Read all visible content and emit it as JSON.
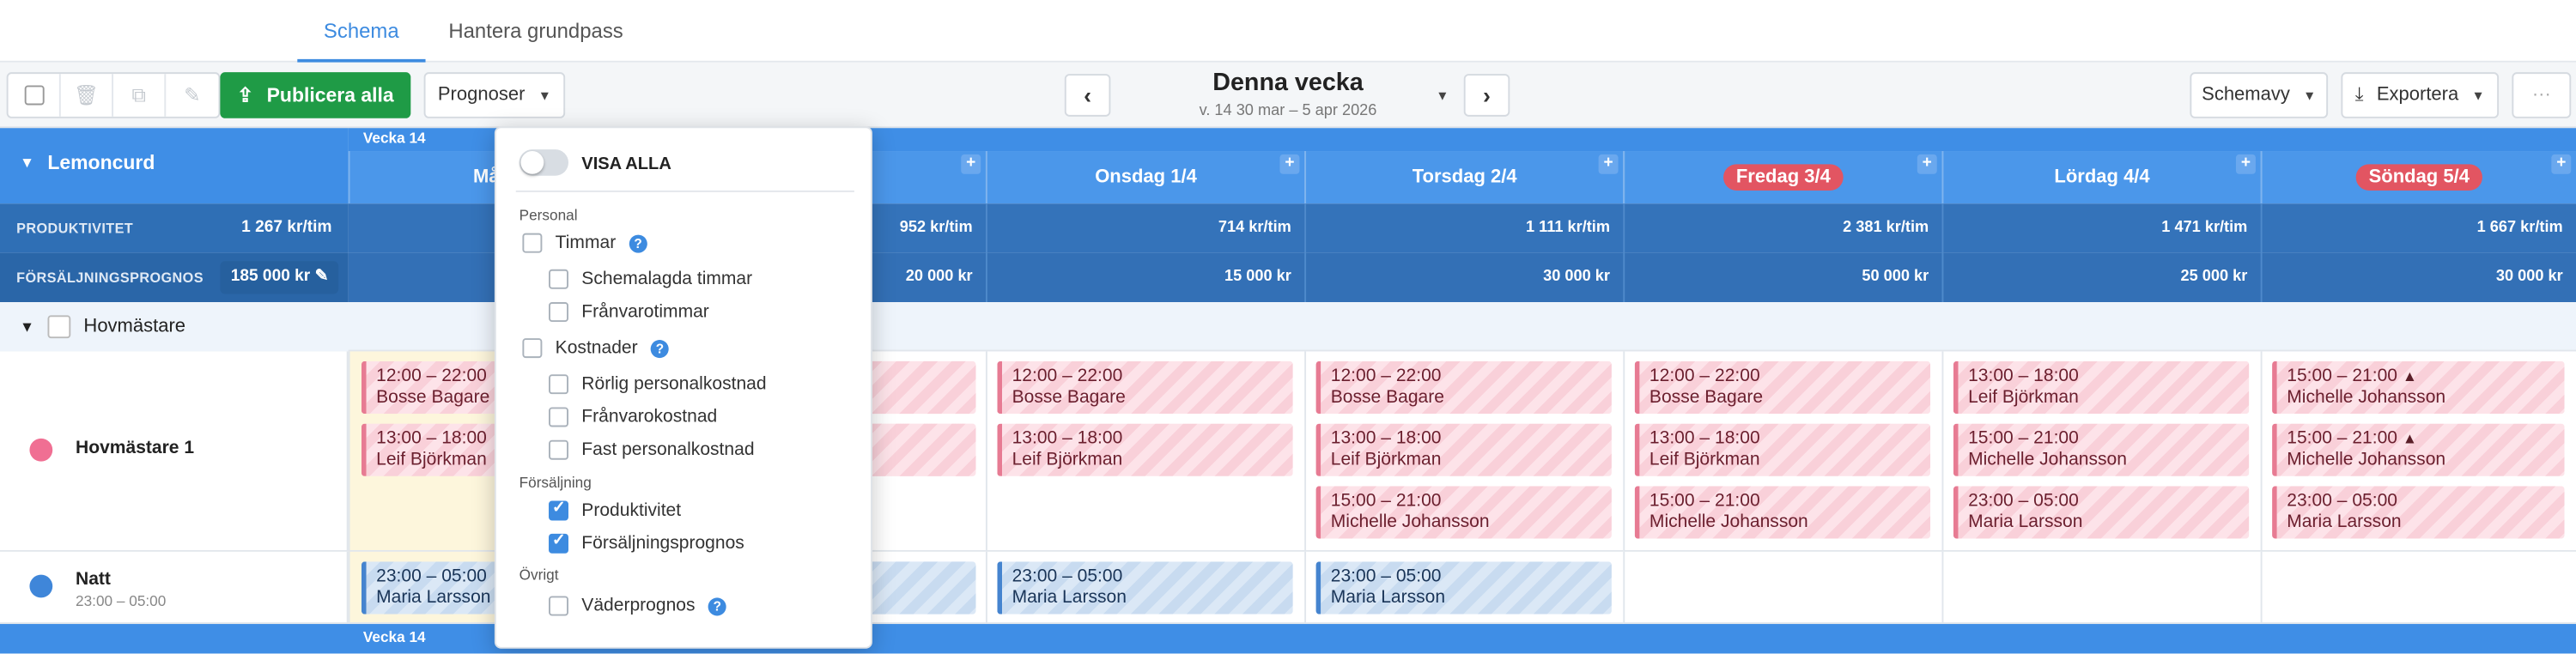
{
  "tabs": [
    {
      "label": "Schema",
      "active": true
    },
    {
      "label": "Hantera grundpass",
      "active": false
    }
  ],
  "toolbar": {
    "publish_label": "Publicera alla",
    "prognoser_label": "Prognoser",
    "week_title": "Denna vecka",
    "week_sub": "v. 14  30 mar – 5 apr 2026",
    "schemavy_label": "Schemavy",
    "exportera_label": "Exportera"
  },
  "colors": {
    "accent": "#3d8be0",
    "publish": "#1f9b46",
    "header": "#3f8ee6",
    "pink_shift": "#e77b93",
    "blue_shift": "#4584cf"
  },
  "grid": {
    "group_title": "Lemoncurd",
    "week_label": "Vecka 14",
    "productivity_label": "PRODUKTIVITET",
    "productivity_total": "1 267 kr/tim",
    "forecast_label": "FÖRSÄLJNINGSPROGNOS",
    "forecast_total": "185 000 kr",
    "days": [
      {
        "label": "Månd",
        "productivity": "",
        "forecast": ""
      },
      {
        "label": "",
        "productivity": "952 kr/tim",
        "forecast": "20 000 kr"
      },
      {
        "label": "Onsdag 1/4",
        "productivity": "714 kr/tim",
        "forecast": "15 000 kr"
      },
      {
        "label": "Torsdag 2/4",
        "productivity": "1 111 kr/tim",
        "forecast": "30 000 kr"
      },
      {
        "label": "Fredag 3/4",
        "productivity": "2 381 kr/tim",
        "forecast": "50 000 kr"
      },
      {
        "label": "Lördag 4/4",
        "productivity": "1 471 kr/tim",
        "forecast": "25 000 kr"
      },
      {
        "label": "Söndag 5/4",
        "productivity": "1 667 kr/tim",
        "forecast": "30 000 kr"
      }
    ],
    "section_label": "Hovmästare",
    "resources": [
      {
        "name": "Hovmästare 1",
        "sub": "",
        "color": "#f06f93"
      },
      {
        "name": "Natt",
        "sub": "23:00 – 05:00",
        "color": "#3f86d9"
      }
    ],
    "shifts": {
      "mon": [
        {
          "time": "12:00 – 22:00",
          "person": "Bosse Bagare"
        },
        {
          "time": "13:00 – 18:00",
          "person": "Leif Björkman"
        }
      ],
      "mon_night": {
        "time": "23:00 – 05:00",
        "person": "Maria Larsson"
      },
      "wed": [
        {
          "time": "12:00 – 22:00",
          "person": "Bosse Bagare"
        },
        {
          "time": "13:00 – 18:00",
          "person": "Leif Björkman"
        }
      ],
      "wed_night": {
        "time": "23:00 – 05:00",
        "person": "Maria Larsson"
      },
      "thu": [
        {
          "time": "12:00 – 22:00",
          "person": "Bosse Bagare"
        },
        {
          "time": "13:00 – 18:00",
          "person": "Leif Björkman"
        },
        {
          "time": "15:00 – 21:00",
          "person": "Michelle Johansson"
        }
      ],
      "thu_night": {
        "time": "23:00 – 05:00",
        "person": "Maria Larsson"
      },
      "fri": [
        {
          "time": "12:00 – 22:00",
          "person": "Bosse Bagare"
        },
        {
          "time": "13:00 – 18:00",
          "person": "Leif Björkman"
        },
        {
          "time": "15:00 – 21:00",
          "person": "Michelle Johansson"
        }
      ],
      "sat": [
        {
          "time": "13:00 – 18:00",
          "person": "Leif Björkman"
        },
        {
          "time": "15:00 – 21:00",
          "person": "Michelle Johansson"
        },
        {
          "time": "23:00 – 05:00",
          "person": "Maria Larsson"
        }
      ],
      "sun": [
        {
          "time": "15:00 – 21:00",
          "person": "Michelle Johansson"
        },
        {
          "time": "15:00 – 21:00",
          "person": "Michelle Johansson"
        },
        {
          "time": "23:00 – 05:00",
          "person": "Maria Larsson"
        }
      ]
    }
  },
  "dropdown": {
    "visa_alla": "VISA ALLA",
    "personal": "Personal",
    "timmar": "Timmar",
    "schemalagda": "Schemalagda timmar",
    "franvarotimmar": "Frånvarotimmar",
    "kostnader": "Kostnader",
    "rorlig": "Rörlig personalkostnad",
    "franvarokostnad": "Frånvarokostnad",
    "fast": "Fast personalkostnad",
    "forsaljning": "Försäljning",
    "produktivitet": "Produktivitet",
    "forsaljningsprognos": "Försäljningsprognos",
    "ovrigt": "Övrigt",
    "vaderprognos": "Väderprognos"
  }
}
